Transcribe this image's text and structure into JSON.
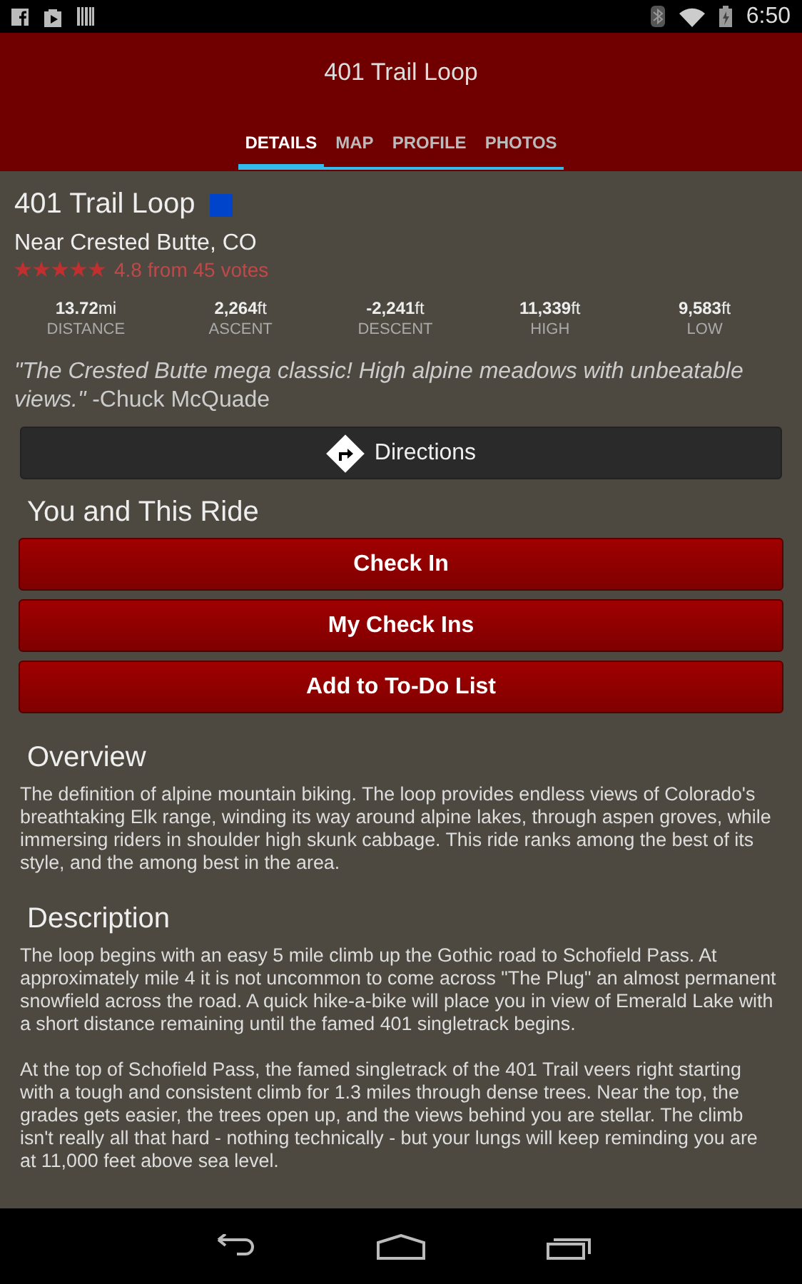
{
  "status_bar": {
    "time": "6:50"
  },
  "header": {
    "title": "401 Trail Loop"
  },
  "tabs": [
    {
      "label": "DETAILS",
      "selected": true
    },
    {
      "label": "MAP",
      "selected": false
    },
    {
      "label": "PROFILE",
      "selected": false
    },
    {
      "label": "PHOTOS",
      "selected": false
    }
  ],
  "trail": {
    "name": "401 Trail Loop",
    "color": "#0044cc",
    "location": "Near Crested Butte, CO",
    "stars": 5,
    "rating": "4.8 from 45 votes"
  },
  "stats": [
    {
      "value": "13.72",
      "unit": "mi",
      "label": "DISTANCE"
    },
    {
      "value": "2,264",
      "unit": "ft",
      "label": "ASCENT"
    },
    {
      "value": "-2,241",
      "unit": "ft",
      "label": "DESCENT"
    },
    {
      "value": "11,339",
      "unit": "ft",
      "label": "HIGH"
    },
    {
      "value": "9,583",
      "unit": "ft",
      "label": "LOW"
    }
  ],
  "quote": "*\"The Crested Butte mega classic! High alpine meadows with unbeatable views.\"* -Chuck McQuade",
  "directions_button": "Directions",
  "ride_section": {
    "heading": "You and This Ride",
    "buttons": [
      "Check In",
      "My Check Ins",
      "Add to To-Do List"
    ]
  },
  "sections": [
    {
      "heading": "Overview",
      "paragraphs": [
        "The definition of alpine mountain biking. The loop provides endless views of Colorado's breathtaking Elk range, winding its way around alpine lakes, through aspen groves, while immersing riders in shoulder high skunk cabbage. This ride ranks among the best of its style, and the among best in the area."
      ]
    },
    {
      "heading": "Description",
      "paragraphs": [
        "The loop begins with an easy 5 mile climb up the Gothic road to Schofield Pass.  At approximately mile 4 it is not uncommon to come across \"The Plug\" an almost permanent snowfield across the road. A quick hike-a-bike will place you in view of Emerald Lake with a short distance remaining until the famed 401 singletrack begins.",
        "At the top of Schofield Pass, the famed singletrack of the 401 Trail veers right starting with a tough and consistent climb for 1.3 miles through dense trees.  Near the top, the grades gets easier, the trees open up, and the views behind you are stellar.  The climb isn't really all that hard - nothing technically - but your lungs will keep reminding you are at 11,000 feet above sea level."
      ]
    }
  ]
}
